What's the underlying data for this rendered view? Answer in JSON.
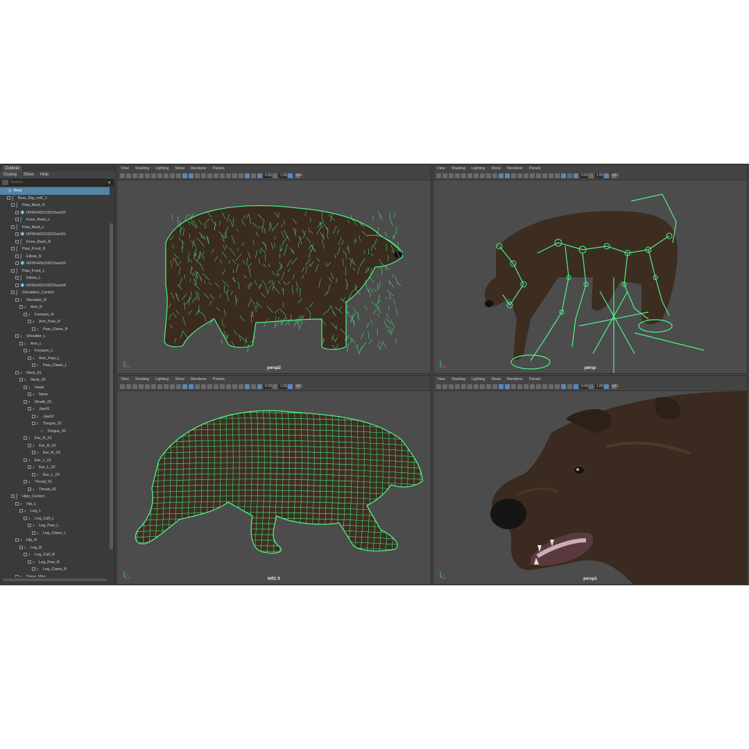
{
  "outliner": {
    "tab": "Outliner",
    "menu": [
      "Display",
      "Show",
      "Help"
    ],
    "search_placeholder": "Search...",
    "items": [
      {
        "label": "Bear",
        "indent": 0,
        "icon": "mesh",
        "selected": true
      },
      {
        "label": "Bear_Rig_col1_1",
        "indent": 1,
        "icon": "ctrl"
      },
      {
        "label": "Paw_Back_R",
        "indent": 2,
        "icon": "ctrl"
      },
      {
        "label": "IKFBXASC032Chain02",
        "indent": 3,
        "icon": "star"
      },
      {
        "label": "Knee_Back_L",
        "indent": 3,
        "icon": "ctrl"
      },
      {
        "label": "Paw_Back_L",
        "indent": 2,
        "icon": "ctrl"
      },
      {
        "label": "IKFBXASC032Chain01",
        "indent": 3,
        "icon": "star"
      },
      {
        "label": "Knee_Back_R",
        "indent": 3,
        "icon": "ctrl"
      },
      {
        "label": "Paw_Front_R",
        "indent": 2,
        "icon": "ctrl"
      },
      {
        "label": "Elbow_R",
        "indent": 3,
        "icon": "ctrl"
      },
      {
        "label": "IKFBXASC032Chain03",
        "indent": 3,
        "icon": "star"
      },
      {
        "label": "Paw_Front_L",
        "indent": 2,
        "icon": "ctrl"
      },
      {
        "label": "Elbow_L",
        "indent": 3,
        "icon": "ctrl"
      },
      {
        "label": "IKFBXASC032Chain04",
        "indent": 3,
        "icon": "star"
      },
      {
        "label": "Shoulders_Control",
        "indent": 2,
        "icon": "ctrl"
      },
      {
        "label": "Shoulder_R",
        "indent": 3,
        "icon": "joint"
      },
      {
        "label": "Arm_R",
        "indent": 4,
        "icon": "joint"
      },
      {
        "label": "Forearm_R",
        "indent": 5,
        "icon": "joint"
      },
      {
        "label": "Arm_Paw_R",
        "indent": 6,
        "icon": "joint"
      },
      {
        "label": "Paw_Claws_R",
        "indent": 7,
        "icon": "joint"
      },
      {
        "label": "Shoulder_L",
        "indent": 3,
        "icon": "joint"
      },
      {
        "label": "Arm_L",
        "indent": 4,
        "icon": "joint"
      },
      {
        "label": "Forearm_L",
        "indent": 5,
        "icon": "joint"
      },
      {
        "label": "Arm_Paw_L",
        "indent": 6,
        "icon": "joint"
      },
      {
        "label": "Paw_Claws_L",
        "indent": 7,
        "icon": "joint"
      },
      {
        "label": "Neck_01",
        "indent": 3,
        "icon": "joint"
      },
      {
        "label": "Neck_02",
        "indent": 4,
        "icon": "joint"
      },
      {
        "label": "Head",
        "indent": 5,
        "icon": "joint"
      },
      {
        "label": "Nose",
        "indent": 6,
        "icon": "joint"
      },
      {
        "label": "Mouth_01",
        "indent": 5,
        "icon": "joint"
      },
      {
        "label": "Jaw01",
        "indent": 6,
        "icon": "joint"
      },
      {
        "label": "Jaw02",
        "indent": 7,
        "icon": "joint"
      },
      {
        "label": "Tongue_01",
        "indent": 7,
        "icon": "joint"
      },
      {
        "label": "Tongue_02",
        "indent": 8,
        "icon": "joint"
      },
      {
        "label": "Ear_R_01",
        "indent": 5,
        "icon": "joint"
      },
      {
        "label": "Ear_R_02",
        "indent": 6,
        "icon": "joint"
      },
      {
        "label": "Ear_R_03",
        "indent": 7,
        "icon": "joint"
      },
      {
        "label": "Ear_L_01",
        "indent": 5,
        "icon": "joint"
      },
      {
        "label": "Ear_L_02",
        "indent": 6,
        "icon": "joint"
      },
      {
        "label": "Ear_L_03",
        "indent": 7,
        "icon": "joint"
      },
      {
        "label": "Throat_01",
        "indent": 5,
        "icon": "joint"
      },
      {
        "label": "Throat_02",
        "indent": 6,
        "icon": "joint"
      },
      {
        "label": "Hips_Control",
        "indent": 2,
        "icon": "ctrl"
      },
      {
        "label": "Hip_L",
        "indent": 3,
        "icon": "joint"
      },
      {
        "label": "Leg_L",
        "indent": 4,
        "icon": "joint"
      },
      {
        "label": "Leg_Calf_L",
        "indent": 5,
        "icon": "joint"
      },
      {
        "label": "Leg_Paw_L",
        "indent": 6,
        "icon": "joint"
      },
      {
        "label": "Leg_Claws_L",
        "indent": 7,
        "icon": "joint"
      },
      {
        "label": "Hip_R",
        "indent": 3,
        "icon": "joint"
      },
      {
        "label": "Leg_R",
        "indent": 4,
        "icon": "joint"
      },
      {
        "label": "Leg_Calf_R",
        "indent": 5,
        "icon": "joint"
      },
      {
        "label": "Leg_Paw_R",
        "indent": 6,
        "icon": "joint"
      },
      {
        "label": "Leg_Claws_R",
        "indent": 7,
        "icon": "joint"
      },
      {
        "label": "Spine_Mini",
        "indent": 3,
        "icon": "joint"
      }
    ]
  },
  "viewport_menu": [
    "View",
    "Shading",
    "Lighting",
    "Show",
    "Renderer",
    "Panels"
  ],
  "toolbar": {
    "exposure": "0.00",
    "gamma": "1.00",
    "colorspace": "sRG"
  },
  "viewports": {
    "top_left": {
      "camera": "persp2",
      "mode": "fur"
    },
    "top_right": {
      "camera": "persp",
      "mode": "skeleton"
    },
    "bottom_left": {
      "camera": "left1 X",
      "mode": "wireframe"
    },
    "bottom_right": {
      "camera": "persp1",
      "mode": "closeup"
    }
  },
  "colors": {
    "wire": "#4cf58a",
    "fur": "#3b2a1e",
    "selection": "#5285a6",
    "viewport_bg": "#4c4c4c"
  }
}
